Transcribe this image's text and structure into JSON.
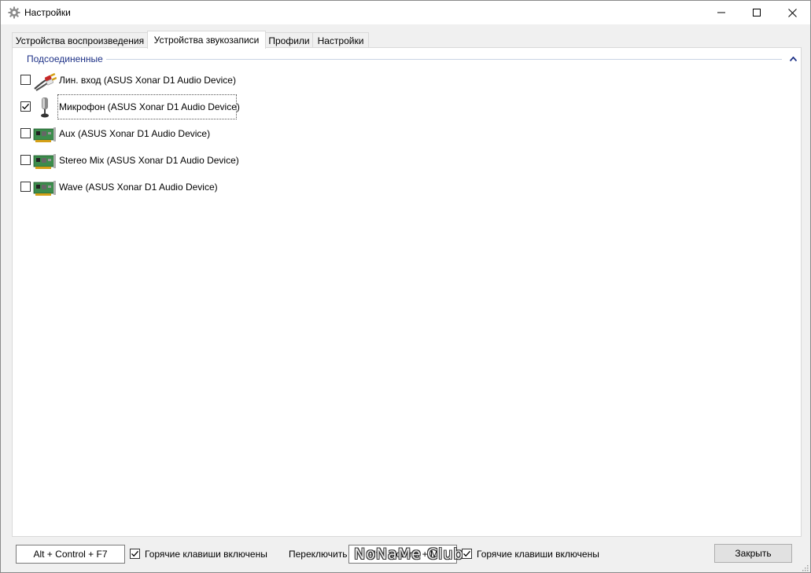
{
  "window": {
    "title": "Настройки",
    "icon": "gear-icon",
    "controls": {
      "minimize": "minimize-icon",
      "maximize": "maximize-icon",
      "close": "close-icon"
    }
  },
  "tabs": [
    {
      "label": "Устройства воспроизведения",
      "active": false
    },
    {
      "label": "Устройства звукозаписи",
      "active": true
    },
    {
      "label": "Профили",
      "active": false
    },
    {
      "label": "Настройки",
      "active": false
    }
  ],
  "group": {
    "title": "Подсоединенные",
    "collapse_icon": "chevron-up-icon",
    "accent_color": "#1e3287"
  },
  "devices": [
    {
      "label": "Лин. вход (ASUS Xonar D1 Audio Device)",
      "checked": false,
      "icon": "line-in-cable-icon"
    },
    {
      "label": "Микрофон (ASUS Xonar D1 Audio Device)",
      "checked": true,
      "icon": "microphone-icon",
      "focused": true
    },
    {
      "label": "Aux (ASUS Xonar D1 Audio Device)",
      "checked": false,
      "icon": "sound-card-icon"
    },
    {
      "label": "Stereo Mix (ASUS Xonar D1 Audio Device)",
      "checked": false,
      "icon": "sound-card-icon"
    },
    {
      "label": "Wave (ASUS Xonar D1 Audio Device)",
      "checked": false,
      "icon": "sound-card-icon"
    }
  ],
  "bottom": {
    "hotkey1": "Alt + Control + F7",
    "hotkeys_enabled1_label": "Горячие клавиши включены",
    "hotkeys_enabled1_checked": true,
    "switch_label": "Переключить",
    "hotkey2": "Alt + Control + M",
    "hotkeys_enabled2_label": "Горячие клавиши включены",
    "hotkeys_enabled2_checked": true,
    "close_label": "Закрыть",
    "watermark": "NoNaMe Club"
  }
}
